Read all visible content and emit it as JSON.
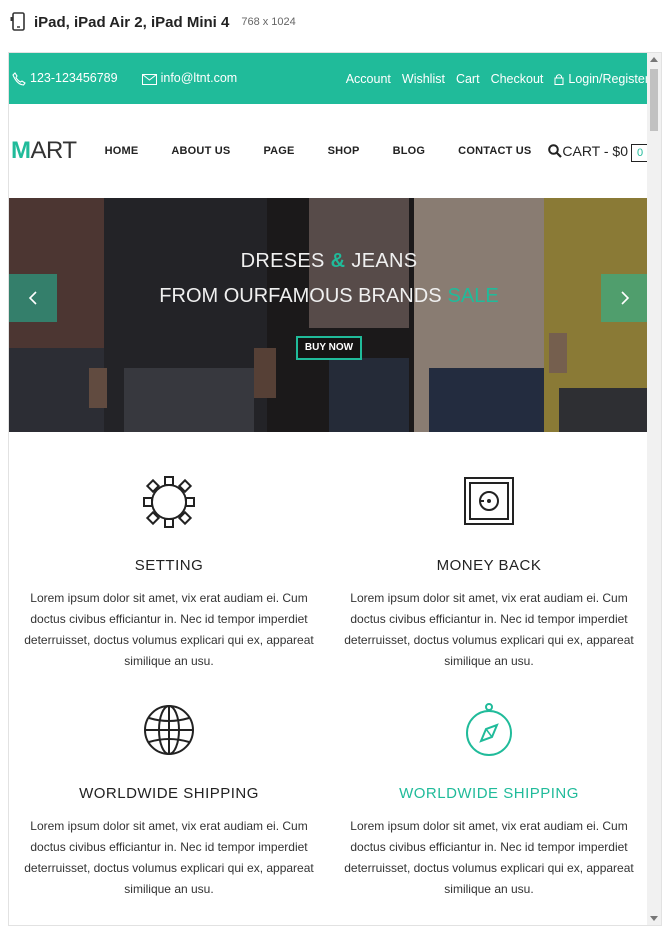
{
  "device": {
    "title": "iPad, iPad Air 2, iPad Mini 4",
    "size": "768 x 1024"
  },
  "topbar": {
    "phone": "123-123456789",
    "email": "info@ltnt.com",
    "links": [
      "Account",
      "Wishlist",
      "Cart",
      "Checkout"
    ],
    "login": "Login/Register",
    "color": "#20bb9a"
  },
  "nav": {
    "logo_first": "M",
    "logo_rest": "ART",
    "items": [
      "HOME",
      "ABOUT US",
      "PAGE",
      "SHOP",
      "BLOG",
      "CONTACT US"
    ],
    "cart_label": "CART - $0",
    "cart_count": "0"
  },
  "hero": {
    "line1_a": "DRESES",
    "line1_amp": "&",
    "line1_b": "JEANS",
    "line2": "FROM OURFAMOUS BRANDS",
    "line2_sale": "SALE",
    "button": "BUY NOW"
  },
  "features": [
    {
      "icon": "gear-icon",
      "title": "SETTING",
      "text": "Lorem ipsum dolor sit amet, vix erat audiam ei. Cum doctus civibus efficiantur in. Nec id tempor imperdiet deterruisset, doctus volumus explicari qui ex, appareat similique an usu."
    },
    {
      "icon": "safe-icon",
      "title": "MONEY BACK",
      "text": "Lorem ipsum dolor sit amet, vix erat audiam ei. Cum doctus civibus efficiantur in. Nec id tempor imperdiet deterruisset, doctus volumus explicari qui ex, appareat similique an usu."
    },
    {
      "icon": "globe-icon",
      "title": "WORLDWIDE SHIPPING",
      "text": "Lorem ipsum dolor sit amet, vix erat audiam ei. Cum doctus civibus efficiantur in. Nec id tempor imperdiet deterruisset, doctus volumus explicari qui ex, appareat similique an usu."
    },
    {
      "icon": "compass-icon",
      "title": "WORLDWIDE SHIPPING",
      "text": "Lorem ipsum dolor sit amet, vix erat audiam ei. Cum doctus civibus efficiantur in. Nec id tempor imperdiet deterruisset, doctus volumus explicari qui ex, appareat similique an usu."
    }
  ],
  "colors": {
    "accent": "#20bb9a",
    "text": "#222222"
  }
}
